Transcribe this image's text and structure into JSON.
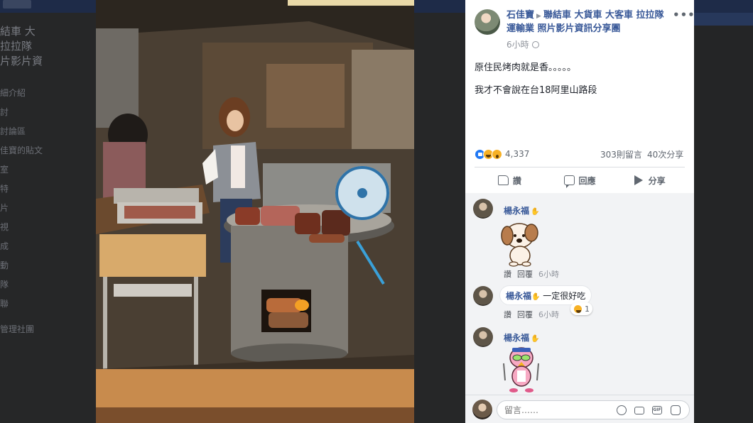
{
  "background": {
    "title_lines": [
      "結車 大",
      "拉拉隊",
      "片影片資"
    ],
    "menu_items": [
      "細介紹",
      "討",
      "討論區",
      "佳寶的貼文",
      "室",
      "特",
      "片",
      "視",
      "成",
      "動",
      "隊",
      "聯"
    ],
    "footer": "管理社團"
  },
  "post": {
    "author": "石佳寶",
    "group": "聯結車 大貨車 大客車 拉拉隊 運輸業 照片影片資訊分享團",
    "time": "6小時",
    "more": "•••",
    "text_line1": "原住民烤肉就是香。。。。。",
    "text_line2": "我才不會說在台18阿里山路段",
    "reaction_count": "4,337",
    "comment_count": "303則留言",
    "share_count": "40次分享",
    "actions": {
      "like": "讚",
      "comment": "回應",
      "share": "分享"
    }
  },
  "comments": [
    {
      "name": "楊永福",
      "text": "",
      "like": "讚",
      "reply": "回覆",
      "time": "6小時",
      "sticker": "dog-sticker"
    },
    {
      "name": "楊永福",
      "text": "一定很好吃",
      "like": "讚",
      "reply": "回覆",
      "time": "6小時",
      "reaction_count": "1"
    },
    {
      "name": "楊永福",
      "text": "",
      "sticker": "bird-sticker"
    }
  ],
  "composer": {
    "placeholder": "留言……"
  }
}
